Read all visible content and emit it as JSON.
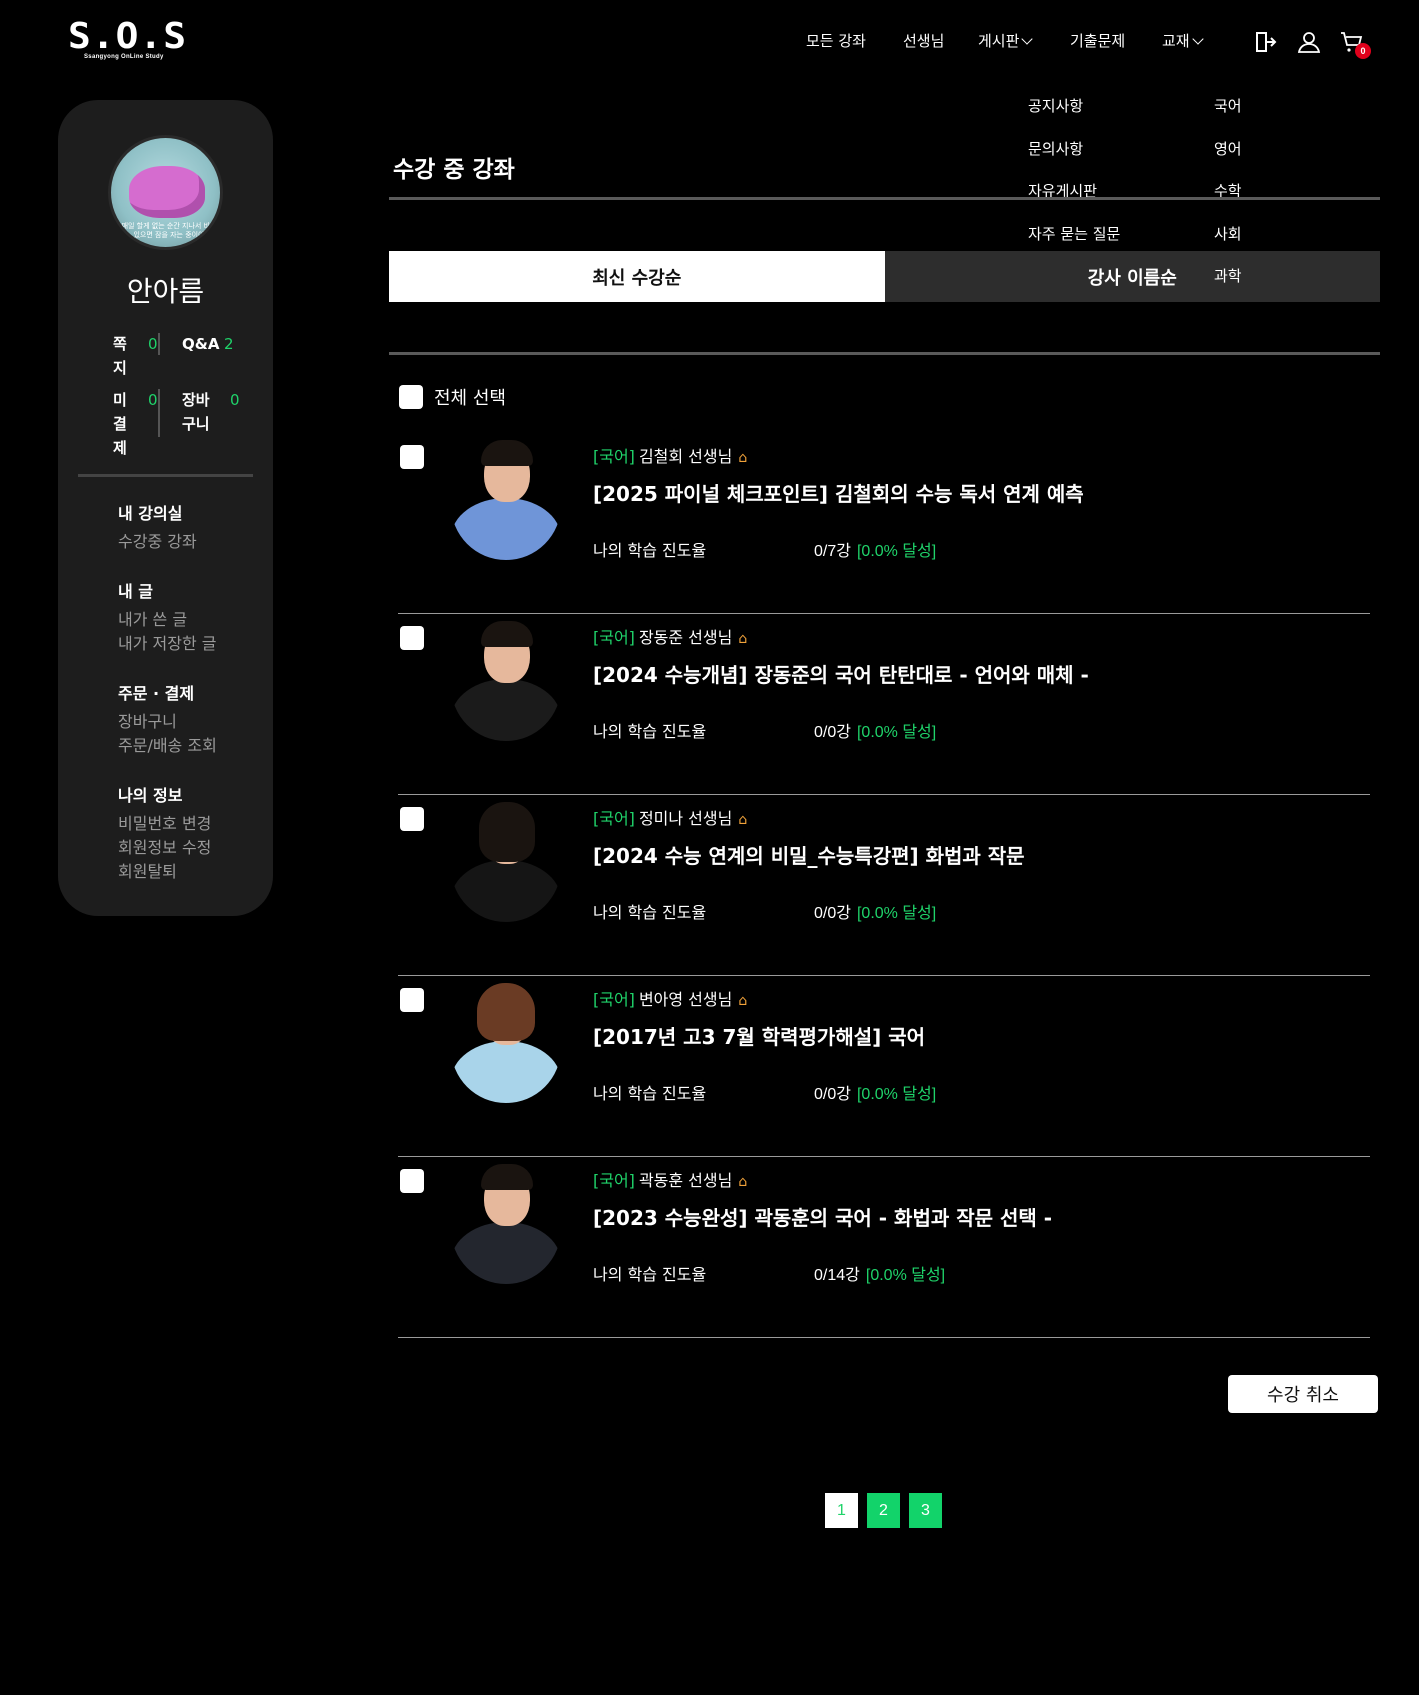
{
  "logo": {
    "text": "S.O.S",
    "subtitle": "Ssangyong OnLine Study"
  },
  "nav": {
    "items": [
      {
        "label": "모든 강좌"
      },
      {
        "label": "선생님"
      },
      {
        "label": "게시판"
      },
      {
        "label": "기출문제"
      },
      {
        "label": "교재"
      }
    ],
    "cart_count": "0"
  },
  "dropdowns": {
    "board": [
      "공지사항",
      "문의사항",
      "자유게시판",
      "자주 묻는 질문"
    ],
    "books": [
      "국어",
      "영어",
      "수학",
      "사회",
      "과학"
    ]
  },
  "sidebar": {
    "avatar_caption": "매일 할게 없는 순간 지나서 비어있으면 잠을 자는 중이야",
    "user_name": "안아름",
    "stats": [
      {
        "label": "쪽\n지",
        "value": "0"
      },
      {
        "label": "Q&A",
        "value": "2"
      },
      {
        "label": "미\n결\n제",
        "value": "0"
      },
      {
        "label": "장바\n구니",
        "value": "0"
      }
    ],
    "sections": [
      {
        "heading": "내 강의실",
        "links": [
          "수강중 강좌"
        ]
      },
      {
        "heading": "내 글",
        "links": [
          "내가 쓴 글",
          "내가 저장한 글"
        ]
      },
      {
        "heading": "주문 · 결제",
        "links": [
          "장바구니",
          "주문/배송 조회"
        ]
      },
      {
        "heading": "나의 정보",
        "links": [
          "비밀번호 변경",
          "회원정보 수정",
          "회원탈퇴"
        ]
      }
    ]
  },
  "main": {
    "title": "수강 중 강좌",
    "tabs": [
      {
        "label": "최신 수강순"
      },
      {
        "label": "강사 이름순"
      }
    ],
    "select_all": "전체 선택",
    "courses": [
      {
        "subject": "[국어]",
        "teacher": "김철회 선생님",
        "title": "[2025 파이널 체크포인트] 김철회의 수능 독서 연계 예측",
        "progress_label": "나의 학습 진도율",
        "progress_count": "0/7강",
        "progress_pct": "[0.0% 달성]"
      },
      {
        "subject": "[국어]",
        "teacher": "장동준 선생님",
        "title": "[2024 수능개념] 장동준의 국어 탄탄대로 - 언어와 매체 -",
        "progress_label": "나의 학습 진도율",
        "progress_count": "0/0강",
        "progress_pct": "[0.0% 달성]"
      },
      {
        "subject": "[국어]",
        "teacher": "정미나 선생님",
        "title": "[2024 수능 연계의 비밀_수능특강편] 화법과 작문",
        "progress_label": "나의 학습 진도율",
        "progress_count": "0/0강",
        "progress_pct": "[0.0% 달성]"
      },
      {
        "subject": "[국어]",
        "teacher": "변아영 선생님",
        "title": "[2017년 고3 7월 학력평가해설] 국어",
        "progress_label": "나의 학습 진도율",
        "progress_count": "0/0강",
        "progress_pct": "[0.0% 달성]"
      },
      {
        "subject": "[국어]",
        "teacher": "곽동훈 선생님",
        "title": "[2023 수능완성] 곽동훈의 국어 - 화법과 작문 선택 -",
        "progress_label": "나의 학습 진도율",
        "progress_count": "0/14강",
        "progress_pct": "[0.0% 달성]"
      }
    ],
    "cancel_button": "수강 취소",
    "pages": [
      "1",
      "2",
      "3"
    ]
  },
  "colors": {
    "accent": "#1fd36a",
    "background": "#000000",
    "sidebar": "#1d1d1d",
    "badge": "#e0001b"
  }
}
